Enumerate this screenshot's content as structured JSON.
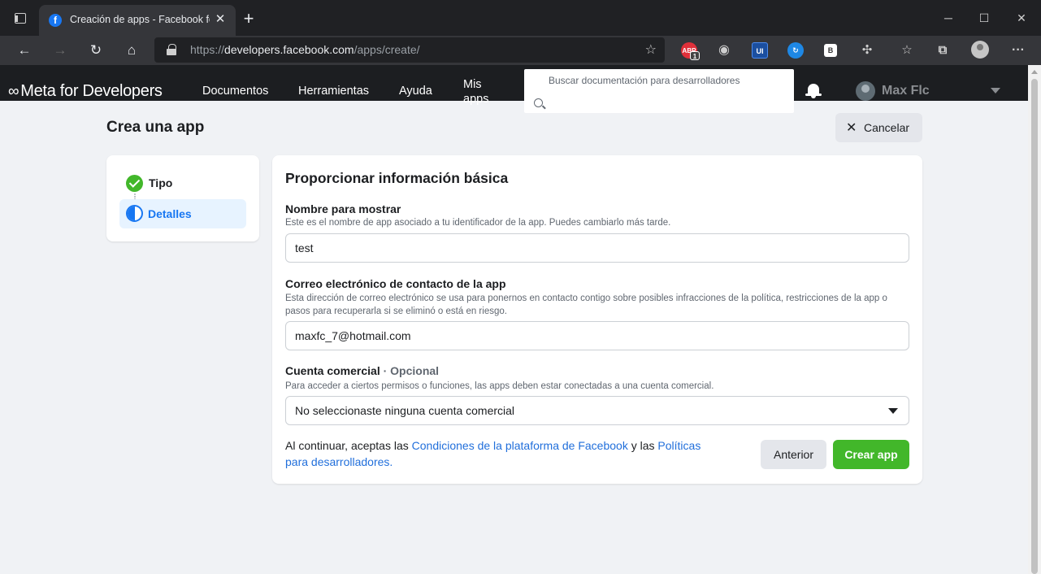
{
  "browser": {
    "tab_title": "Creación de apps - Facebook for",
    "tab_favicon": "facebook-icon",
    "tab_favicon_glyph": "f",
    "url_scheme": "https://",
    "url_host": "developers.facebook.com",
    "url_path": "/apps/create/",
    "ext_abp_label": "ABP",
    "ext_abp_count": "1",
    "ext_ui_label": "UI",
    "ext_b_label": "B"
  },
  "nav": {
    "logo_text": "Meta for Developers",
    "links": [
      "Documentos",
      "Herramientas",
      "Ayuda",
      "Mis apps"
    ],
    "search_placeholder": "Buscar documentación para desarrolladores",
    "user_name": "Max Flc"
  },
  "page": {
    "title": "Crea una app",
    "cancel_label": "Cancelar"
  },
  "steps": [
    {
      "label": "Tipo",
      "state": "completed"
    },
    {
      "label": "Detalles",
      "state": "active"
    }
  ],
  "form": {
    "title": "Proporcionar información básica",
    "display_name": {
      "label": "Nombre para mostrar",
      "help": "Este es el nombre de app asociado a tu identificador de la app. Puedes cambiarlo más tarde.",
      "value": "test"
    },
    "email": {
      "label": "Correo electrónico de contacto de la app",
      "help": "Esta dirección de correo electrónico se usa para ponernos en contacto contigo sobre posibles infracciones de la política, restricciones de la app o pasos para recuperarla si se eliminó o está en riesgo.",
      "value": "maxfc_7@hotmail.com"
    },
    "business": {
      "label": "Cuenta comercial",
      "optional": "· Opcional",
      "help": "Para acceder a ciertos permisos o funciones, las apps deben estar conectadas a una cuenta comercial.",
      "value": "No seleccionaste ninguna cuenta comercial"
    },
    "terms": {
      "prefix": "Al continuar, aceptas las ",
      "link1": "Condiciones de la plataforma de Facebook",
      "middle": " y las ",
      "link2": "Políticas para desarrolladores",
      "suffix": "."
    },
    "prev_label": "Anterior",
    "create_label": "Crear app"
  },
  "colors": {
    "primary_green": "#42b72a",
    "link_blue": "#216fdb",
    "active_blue": "#1877f2",
    "nav_bg": "#1c1e21"
  }
}
